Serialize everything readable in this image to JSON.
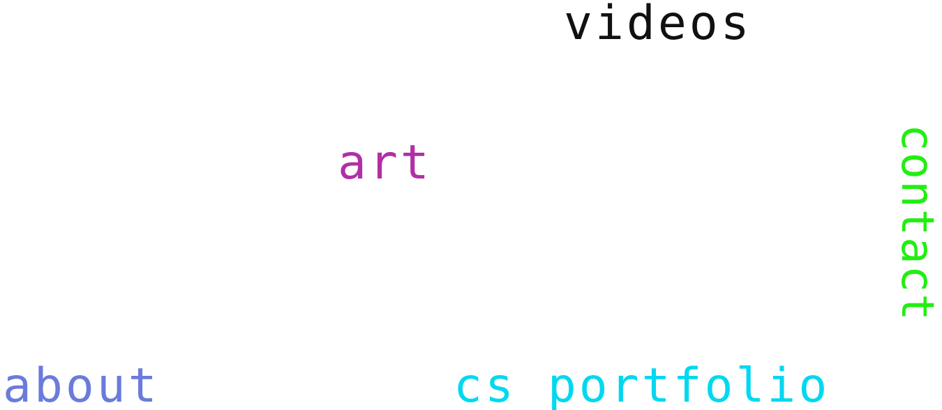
{
  "nav": {
    "videos": {
      "label": "videos",
      "color": "#111111"
    },
    "art": {
      "label": "art",
      "color": "#b12fa6"
    },
    "contact": {
      "label": "contact",
      "color": "#22ee11"
    },
    "about": {
      "label": "about",
      "color": "#6b7bdc"
    },
    "cs_portfolio": {
      "label": "cs portfolio",
      "color": "#00d8f0"
    }
  }
}
